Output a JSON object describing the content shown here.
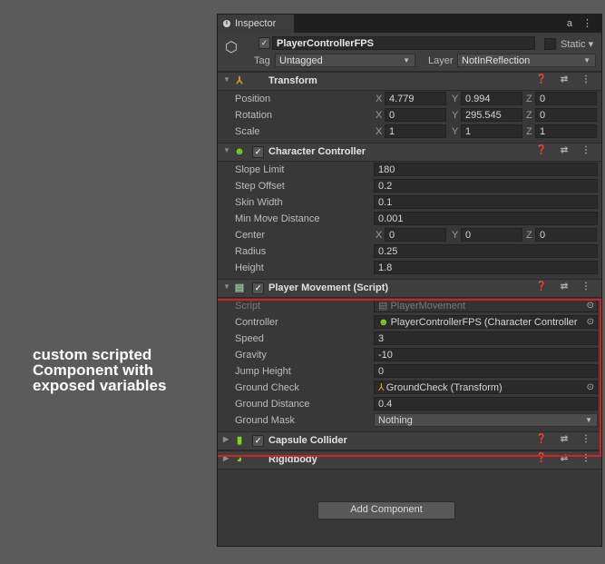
{
  "caption": {
    "line1": "custom scripted",
    "line2": "Component with",
    "line3": "exposed variables"
  },
  "inspector": {
    "tab_label": "Inspector",
    "tab_right_icons": "a ⋮",
    "object": {
      "name": "PlayerControllerFPS",
      "active_check": "✓",
      "static_label": "Static",
      "tag_label": "Tag",
      "tag_value": "Untagged",
      "layer_label": "Layer",
      "layer_value": "NotInReflection"
    },
    "header_icons": "❓ ⇄ ⋮",
    "transform": {
      "title": "Transform",
      "position": {
        "label": "Position",
        "x": "4.779",
        "y": "0.994",
        "z": "0"
      },
      "rotation": {
        "label": "Rotation",
        "x": "0",
        "y": "295.545",
        "z": "0"
      },
      "scale": {
        "label": "Scale",
        "x": "1",
        "y": "1",
        "z": "1"
      },
      "axis_x": "X",
      "axis_y": "Y",
      "axis_z": "Z"
    },
    "character_controller": {
      "title": "Character Controller",
      "slope_limit": {
        "label": "Slope Limit",
        "value": "180"
      },
      "step_offset": {
        "label": "Step Offset",
        "value": "0.2"
      },
      "skin_width": {
        "label": "Skin Width",
        "value": "0.1"
      },
      "min_move": {
        "label": "Min Move Distance",
        "value": "0.001"
      },
      "center": {
        "label": "Center",
        "x": "0",
        "y": "0",
        "z": "0"
      },
      "radius": {
        "label": "Radius",
        "value": "0.25"
      },
      "height": {
        "label": "Height",
        "value": "1.8"
      }
    },
    "player_movement": {
      "title": "Player Movement (Script)",
      "script": {
        "label": "Script",
        "value": "PlayerMovement"
      },
      "controller": {
        "label": "Controller",
        "value": "PlayerControllerFPS (Character Controller"
      },
      "speed": {
        "label": "Speed",
        "value": "3"
      },
      "gravity": {
        "label": "Gravity",
        "value": "-10"
      },
      "jump_height": {
        "label": "Jump Height",
        "value": "0"
      },
      "ground_check": {
        "label": "Ground Check",
        "value": "GroundCheck (Transform)"
      },
      "ground_distance": {
        "label": "Ground Distance",
        "value": "0.4"
      },
      "ground_mask": {
        "label": "Ground Mask",
        "value": "Nothing"
      }
    },
    "capsule_collider": {
      "title": "Capsule Collider"
    },
    "rigidbody": {
      "title": "Rigidbody"
    },
    "add_component_label": "Add Component"
  },
  "colors": {
    "highlight": "#d42222",
    "panel_bg": "#383838",
    "page_bg": "#5b5b5b"
  }
}
